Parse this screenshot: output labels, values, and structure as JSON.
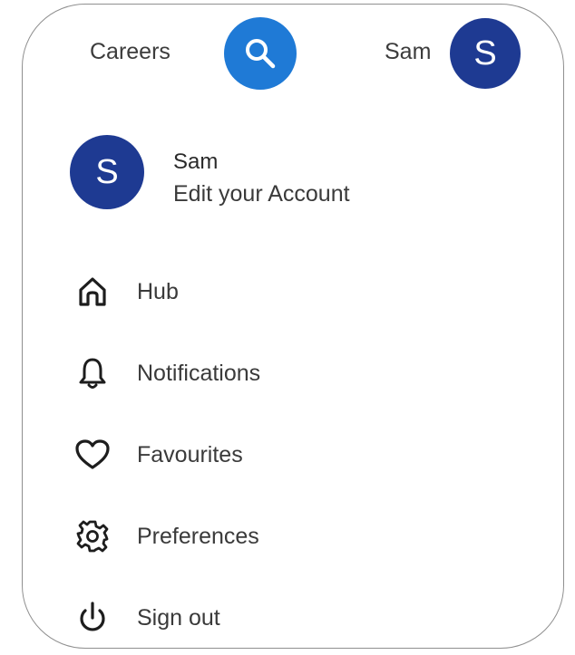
{
  "colors": {
    "search_button_bg": "#1f7ad6",
    "avatar_bg": "#1e3a92",
    "text": "#3a3a3a"
  },
  "header": {
    "careers_label": "Careers",
    "search_icon": "search-icon",
    "user_name": "Sam",
    "avatar_initial": "S"
  },
  "account": {
    "avatar_initial": "S",
    "name": "Sam",
    "subtitle": "Edit your Account"
  },
  "menu": {
    "items": [
      {
        "label": "Hub",
        "icon": "home-icon"
      },
      {
        "label": "Notifications",
        "icon": "bell-icon"
      },
      {
        "label": "Favourites",
        "icon": "heart-icon"
      },
      {
        "label": "Preferences",
        "icon": "gear-icon"
      },
      {
        "label": "Sign out",
        "icon": "power-icon"
      }
    ]
  }
}
